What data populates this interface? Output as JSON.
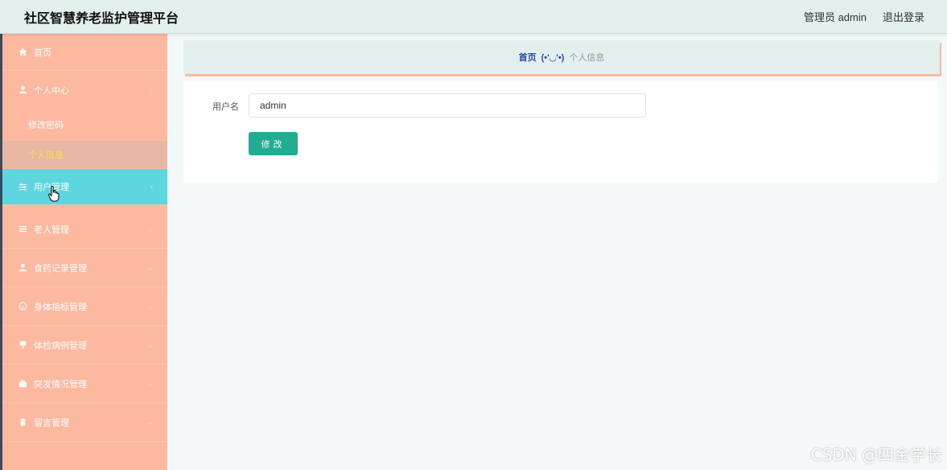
{
  "header": {
    "title": "社区智慧养老监护管理平台",
    "user": "管理员 admin",
    "logout": "退出登录"
  },
  "sidebar": {
    "items": [
      {
        "label": "首页",
        "icon": "home-icon"
      },
      {
        "label": "个人中心",
        "icon": "user-icon"
      },
      {
        "label": "修改密码"
      },
      {
        "label": "个人信息"
      },
      {
        "label": "用户管理",
        "icon": "sliders-icon"
      },
      {
        "label": "老人管理",
        "icon": "list-icon"
      },
      {
        "label": "食药记录管理",
        "icon": "user-icon"
      },
      {
        "label": "身体指标管理",
        "icon": "smile-icon"
      },
      {
        "label": "体检病例管理",
        "icon": "pin-icon"
      },
      {
        "label": "突发情况管理",
        "icon": "briefcase-icon"
      },
      {
        "label": "留言管理",
        "icon": "trash-icon"
      }
    ]
  },
  "breadcrumb": {
    "home": "首页",
    "face": "(•'◡'•)",
    "current": "个人信息"
  },
  "form": {
    "username_label": "用户名",
    "username_value": "admin",
    "submit_label": "修改"
  },
  "watermark": "CSDN @四金学长",
  "colors": {
    "sidebar": "#fdb8a0",
    "highlight": "#5dd6df",
    "accent_button": "#22ac91",
    "header": "#e3efed"
  }
}
